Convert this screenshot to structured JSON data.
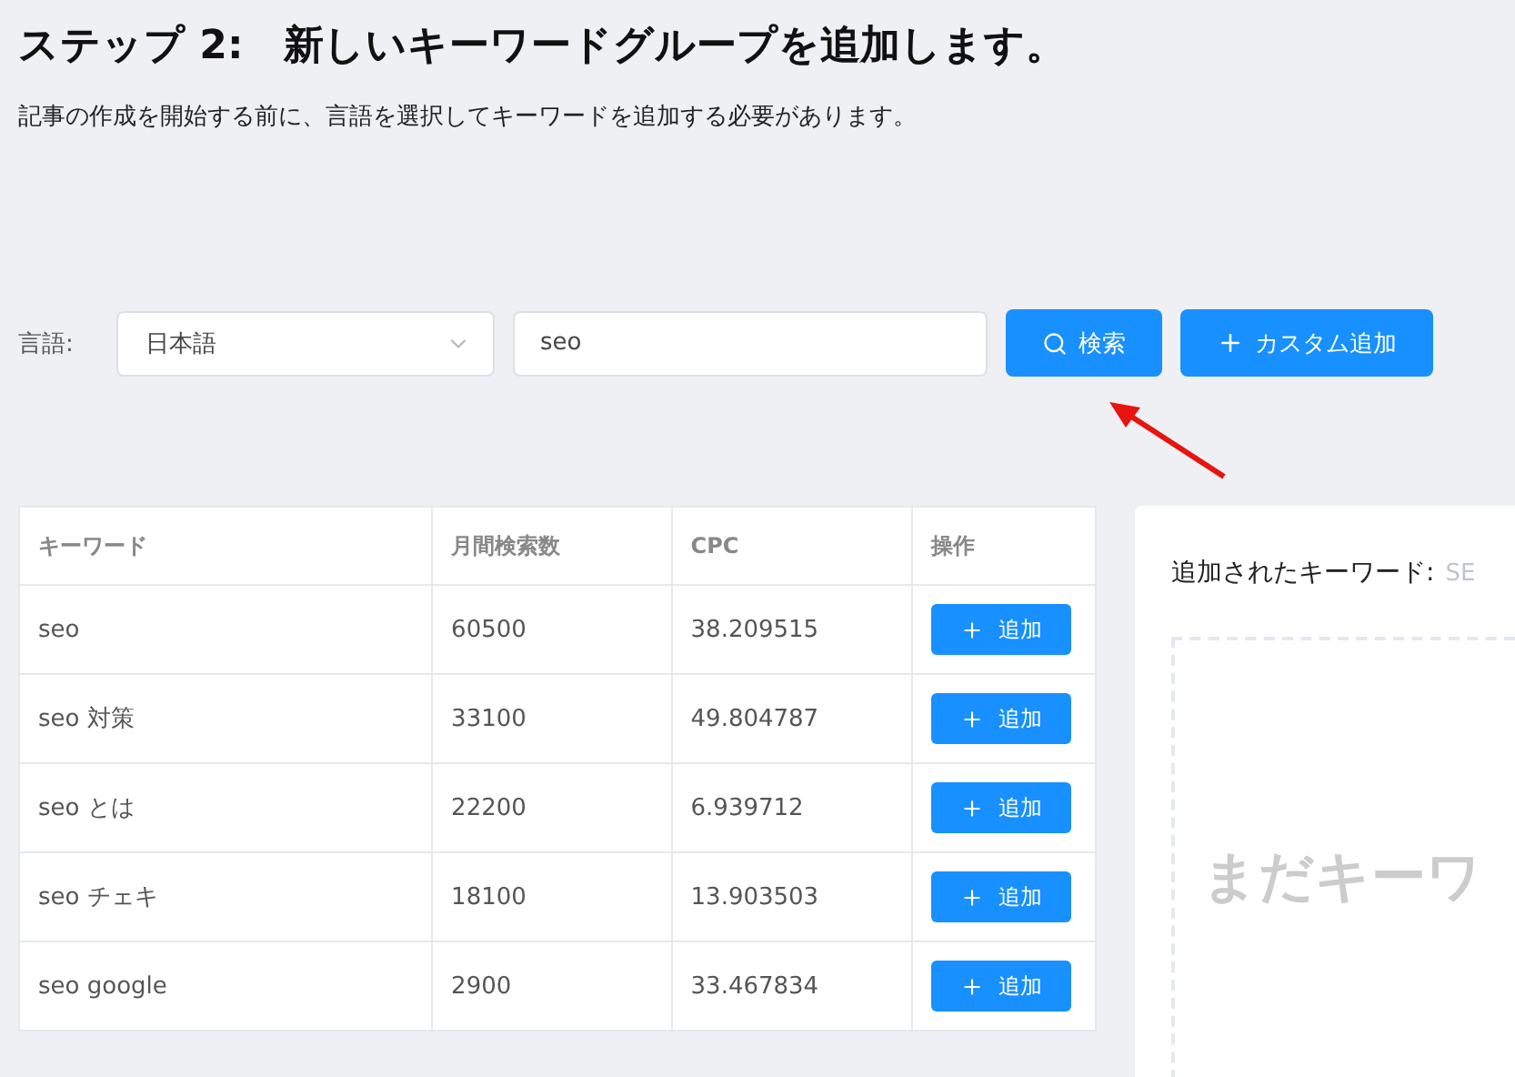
{
  "heading": "ステップ 2:　新しいキーワードグループを追加します。",
  "description": "記事の作成を開始する前に、言語を選択してキーワードを追加する必要があります。",
  "language_label": "言語:",
  "language_select": {
    "value": "日本語"
  },
  "keyword_field": {
    "value": "seo"
  },
  "search_button": "検索",
  "custom_add_button": "カスタム追加",
  "table": {
    "columns": [
      "キーワード",
      "月間検索数",
      "CPC",
      "操作"
    ],
    "rows": [
      {
        "keyword": "seo",
        "volume": "60500",
        "cpc": "38.209515",
        "action": "追加"
      },
      {
        "keyword": "seo 対策",
        "volume": "33100",
        "cpc": "49.804787",
        "action": "追加"
      },
      {
        "keyword": "seo とは",
        "volume": "22200",
        "cpc": "6.939712",
        "action": "追加"
      },
      {
        "keyword": "seo チェキ",
        "volume": "18100",
        "cpc": "13.903503",
        "action": "追加"
      },
      {
        "keyword": "seo google",
        "volume": "2900",
        "cpc": "33.467834",
        "action": "追加"
      }
    ]
  },
  "added_panel": {
    "title": "追加されたキーワード:",
    "subtitle": "SE",
    "empty_text": "まだキーワ"
  }
}
